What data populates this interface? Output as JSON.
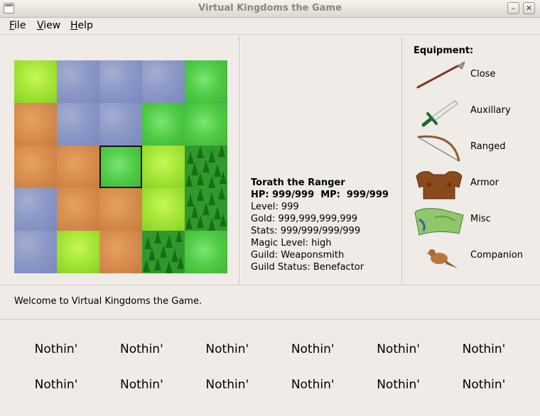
{
  "window": {
    "title": "Virtual Kingdoms the Game"
  },
  "menu": [
    {
      "label": "File",
      "mnemonic": "F",
      "rest": "ile"
    },
    {
      "label": "View",
      "mnemonic": "V",
      "rest": "iew"
    },
    {
      "label": "Help",
      "mnemonic": "H",
      "rest": "elp"
    }
  ],
  "map": {
    "rows": [
      [
        "light",
        "water",
        "water",
        "water",
        "grass"
      ],
      [
        "sand",
        "water",
        "water",
        "grass",
        "grass"
      ],
      [
        "sand",
        "sand",
        "grass",
        "light",
        "forest"
      ],
      [
        "water",
        "sand",
        "sand",
        "light",
        "forest"
      ],
      [
        "water",
        "light",
        "sand",
        "forest",
        "grass"
      ]
    ],
    "selected": {
      "row": 2,
      "col": 2
    }
  },
  "character": {
    "name": "Torath the Ranger",
    "hp_mp": "HP: 999/999  MP:  999/999",
    "level": "Level: 999",
    "gold": "Gold: 999,999,999,999",
    "stats": "Stats: 999/999/999/999",
    "magic": "Magic Level: high",
    "guild": "Guild: Weaponsmith",
    "guild_status": "Guild Status: Benefactor"
  },
  "equipment": {
    "title": "Equipment:",
    "slots": [
      {
        "label": "Close",
        "icon": "spear-icon"
      },
      {
        "label": "Auxillary",
        "icon": "dagger-icon"
      },
      {
        "label": "Ranged",
        "icon": "bow-icon"
      },
      {
        "label": "Armor",
        "icon": "leather-armor-icon"
      },
      {
        "label": "Misc",
        "icon": "map-scroll-icon"
      },
      {
        "label": "Companion",
        "icon": "hawk-icon"
      }
    ]
  },
  "message": "Welcome to Virtual Kingdoms the Game.",
  "inventory": [
    "Nothin'",
    "Nothin'",
    "Nothin'",
    "Nothin'",
    "Nothin'",
    "Nothin'",
    "Nothin'",
    "Nothin'",
    "Nothin'",
    "Nothin'",
    "Nothin'",
    "Nothin'"
  ],
  "colors": {
    "window_bg": "#efebe7",
    "title_text": "#8a857e"
  }
}
